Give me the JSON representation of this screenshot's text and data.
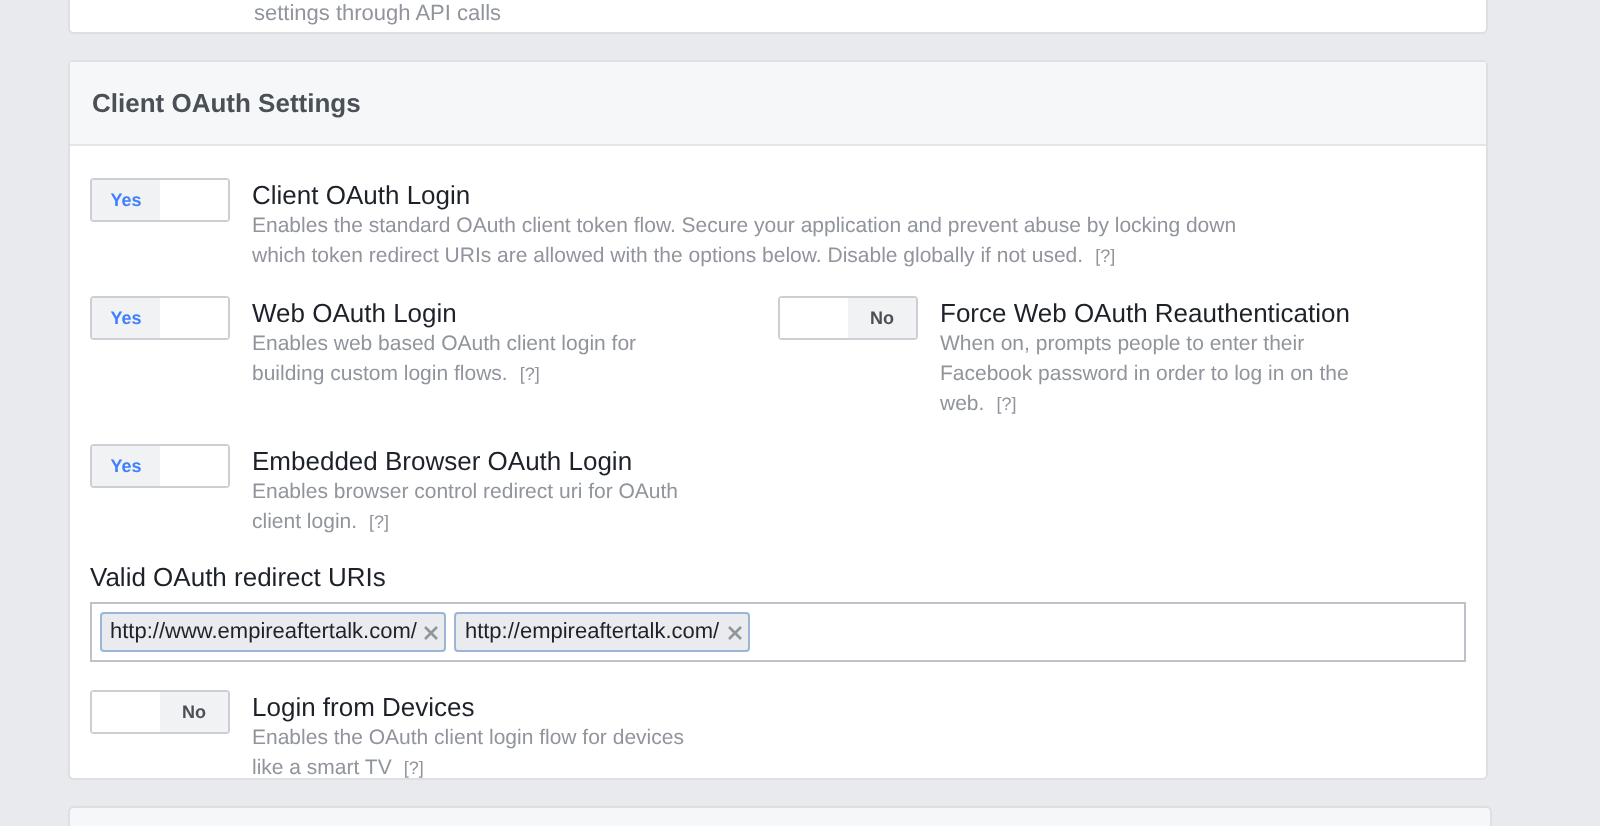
{
  "previous_card": {
    "text": "settings through API calls"
  },
  "card": {
    "title": "Client OAuth Settings",
    "toggle_rows": [
      {
        "settings": [
          {
            "title": "Client OAuth Login",
            "description": "Enables the standard OAuth client token flow. Secure your application and prevent abuse by locking down which token redirect URIs are allowed with the options below. Disable globally if not used.",
            "help": "[?]",
            "on": true,
            "toggle_label": "Yes"
          }
        ]
      },
      {
        "settings": [
          {
            "title": "Web OAuth Login",
            "description": "Enables web based OAuth client login for building custom login flows.",
            "help": "[?]",
            "on": true,
            "toggle_label": "Yes"
          },
          {
            "title": "Force Web OAuth Reauthentication",
            "description": "When on, prompts people to enter their Facebook password in order to log in on the web.",
            "help": "[?]",
            "on": false,
            "toggle_label": "No"
          }
        ]
      },
      {
        "settings": [
          {
            "title": "Embedded Browser OAuth Login",
            "description": "Enables browser control redirect uri for OAuth client login.",
            "help": "[?]",
            "on": true,
            "toggle_label": "Yes"
          }
        ]
      }
    ],
    "redirect_uris": {
      "label": "Valid OAuth redirect URIs",
      "tokens": [
        "http://www.empireaftertalk.com/",
        "http://empireaftertalk.com/"
      ]
    },
    "bottom_rows": [
      {
        "settings": [
          {
            "title": "Login from Devices",
            "description": "Enables the OAuth client login flow for devices like a smart TV",
            "help": "[?]",
            "on": false,
            "toggle_label": "No"
          }
        ]
      }
    ]
  }
}
